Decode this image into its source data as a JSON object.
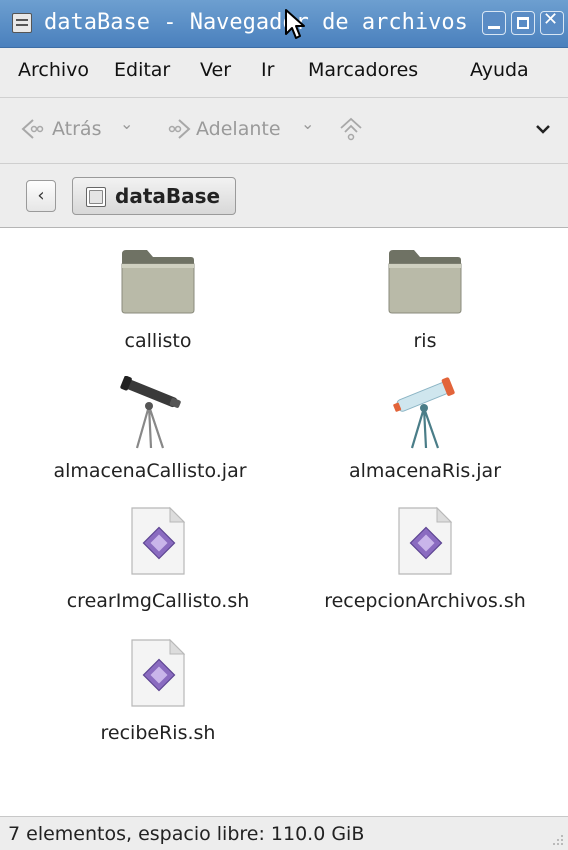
{
  "window": {
    "title": "dataBase - Navegador de archivos"
  },
  "menu": [
    {
      "label": "Archivo"
    },
    {
      "label": "Editar"
    },
    {
      "label": "Ver"
    },
    {
      "label": "Ir"
    },
    {
      "label": "Marcadores"
    },
    {
      "label": "Ayuda"
    }
  ],
  "toolbar": {
    "back_label": "Atrás",
    "forward_label": "Adelante"
  },
  "location": {
    "crumb_label": "dataBase"
  },
  "files": [
    {
      "name": "callisto",
      "icon": "folder-icon"
    },
    {
      "name": "ris",
      "icon": "folder-icon"
    },
    {
      "name": "almacenaCallisto.jar",
      "icon": "telescope-dark-icon"
    },
    {
      "name": "almacenaRis.jar",
      "icon": "telescope-light-icon"
    },
    {
      "name": "crearImgCallisto.sh",
      "icon": "script-file-icon"
    },
    {
      "name": "recepcionArchivos.sh",
      "icon": "script-file-icon"
    },
    {
      "name": "recibeRis.sh",
      "icon": "script-file-icon"
    }
  ],
  "status": {
    "text": "7 elementos, espacio libre: 110.0 GiB"
  },
  "colors": {
    "titlebar": "#4a80bd",
    "chrome": "#ededed",
    "script_icon": "#8a6bc0"
  }
}
